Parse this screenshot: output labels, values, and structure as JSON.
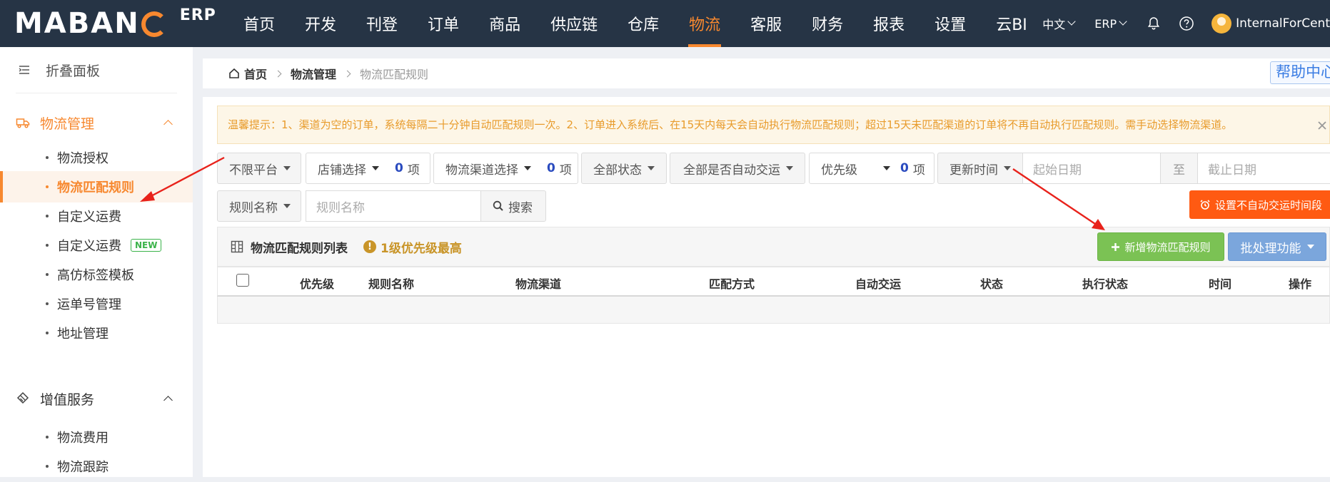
{
  "header": {
    "logo_text": "MABANG",
    "logo_sub": "ERP",
    "nav": [
      {
        "label": "首页",
        "active": false
      },
      {
        "label": "开发",
        "active": false
      },
      {
        "label": "刊登",
        "active": false
      },
      {
        "label": "订单",
        "active": false
      },
      {
        "label": "商品",
        "active": false
      },
      {
        "label": "供应链",
        "active": false
      },
      {
        "label": "仓库",
        "active": false
      },
      {
        "label": "物流",
        "active": true
      },
      {
        "label": "客服",
        "active": false
      },
      {
        "label": "财务",
        "active": false
      },
      {
        "label": "报表",
        "active": false
      },
      {
        "label": "设置",
        "active": false
      },
      {
        "label": "云BI",
        "active": false
      }
    ],
    "lang": "中文",
    "system": "ERP",
    "username": "InternalForCent",
    "accent": "#f7882f",
    "bg": "#263445"
  },
  "sidebar": {
    "collapse_label": "折叠面板",
    "groups": [
      {
        "label": "物流管理",
        "icon": "truck-icon",
        "items": [
          "物流授权",
          "物流匹配规则",
          "自定义运费",
          "自定义运费",
          "高仿标签模板",
          "运单号管理",
          "地址管理"
        ],
        "active_index": 1,
        "new_badge_index": 3
      },
      {
        "label": "增值服务",
        "icon": "diamond-icon",
        "items": [
          "物流费用",
          "物流跟踪"
        ]
      }
    ],
    "new_badge": "NEW"
  },
  "breadcrumb": {
    "home": "首页",
    "level2": "物流管理",
    "level3": "物流匹配规则"
  },
  "help": "帮助中心",
  "tip": "温馨提示：1、渠道为空的订单，系统每隔二十分钟自动匹配规则一次。2、订单进入系统后、在15天内每天会自动执行物流匹配规则；超过15天未匹配渠道的订单将不再自动执行匹配规则。需手动选择物流渠道。",
  "filters": {
    "platform": "不限平台",
    "shop": "店铺选择",
    "shop_count": "0",
    "channel": "物流渠道选择",
    "channel_count": "0",
    "unit": "项",
    "status": "全部状态",
    "auto_ship": "全部是否自动交运",
    "priority": "优先级",
    "priority_count": "0",
    "update_time": "更新时间",
    "start_date_placeholder": "起始日期",
    "to": "至",
    "end_date_placeholder": "截止日期",
    "rule_name_select": "规则名称",
    "rule_name_placeholder": "规则名称",
    "search": "搜索",
    "set_no_auto_ship": "设置不自动交运时间段"
  },
  "list": {
    "title": "物流匹配规则列表",
    "priority_note": "1级优先级最高",
    "add_button": "新增物流匹配规则",
    "batch_button": "批处理功能",
    "columns": [
      "优先级",
      "规则名称",
      "物流渠道",
      "匹配方式",
      "自动交运",
      "状态",
      "执行状态",
      "时间",
      "操作"
    ]
  }
}
